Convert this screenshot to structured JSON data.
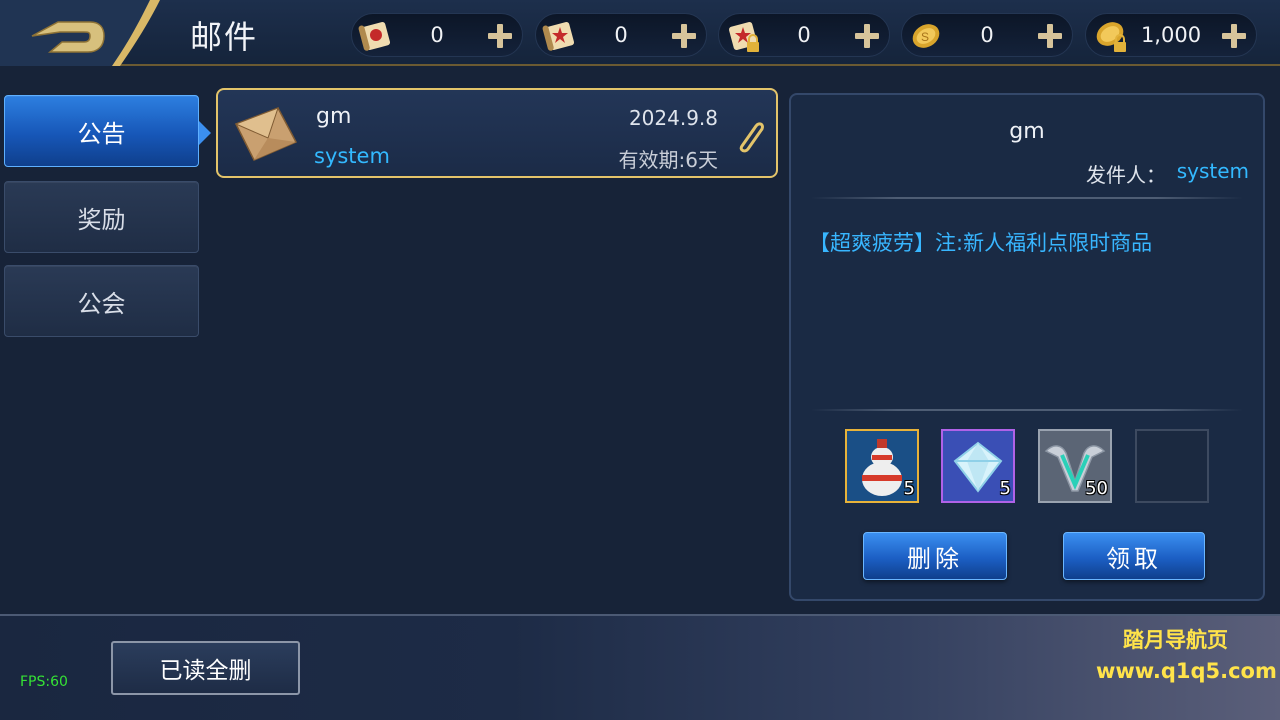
{
  "header": {
    "title": "邮件",
    "currencies": [
      {
        "icon": "red-scroll-icon",
        "value": "0"
      },
      {
        "icon": "star-scroll-icon",
        "value": "0"
      },
      {
        "icon": "locked-scroll-icon",
        "value": "0"
      },
      {
        "icon": "gold-coin-icon",
        "value": "0"
      },
      {
        "icon": "locked-coin-icon",
        "value": "1,000"
      }
    ]
  },
  "tabs": [
    {
      "label": "公告",
      "active": true
    },
    {
      "label": "奖励",
      "active": false
    },
    {
      "label": "公会",
      "active": false
    }
  ],
  "mail_list": [
    {
      "title": "gm",
      "sender": "system",
      "date": "2024.9.8",
      "expiry": "有效期:6天",
      "has_attachment": true
    }
  ],
  "detail": {
    "title": "gm",
    "from_label": "发件人：",
    "from_value": "system",
    "body": "【超爽疲劳】注:新人福利点限时商品",
    "attachments": [
      {
        "icon": "gourd-potion-icon",
        "qty": "5",
        "rarity": "gold"
      },
      {
        "icon": "diamond-gem-icon",
        "qty": "5",
        "rarity": "purple"
      },
      {
        "icon": "v-wings-badge-icon",
        "qty": "50",
        "rarity": "silver"
      },
      {
        "icon": "",
        "qty": "",
        "rarity": "empty"
      }
    ],
    "delete_label": "删除",
    "claim_label": "领取"
  },
  "footer": {
    "fps": "FPS:60",
    "read_all_delete": "已读全删",
    "watermark_line1": "踏月导航页",
    "watermark_line2": "www.q1q5.com"
  },
  "colors": {
    "accent_blue": "#33b9ff",
    "gold_border": "#e3c46a",
    "fps_green": "#35e235",
    "watermark_yellow": "#ffe34a"
  }
}
